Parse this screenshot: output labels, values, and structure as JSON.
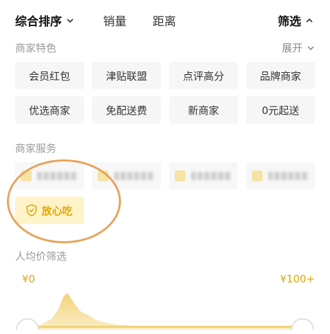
{
  "sort_bar": {
    "tabs": [
      "综合排序",
      "销量",
      "距离"
    ],
    "filter_label": "筛选"
  },
  "features": {
    "label": "商家特色",
    "expand_label": "展开",
    "chips": [
      "会员红包",
      "津贴联盟",
      "点评高分",
      "品牌商家",
      "优选商家",
      "免配送费",
      "新商家",
      "0元起送"
    ]
  },
  "services": {
    "label": "商家服务",
    "highlighted": "放心吃"
  },
  "price_filter": {
    "label": "人均价筛选",
    "min_label": "¥0",
    "max_label": "¥100+"
  },
  "colors": {
    "accent": "#e0a800",
    "highlight_ring": "#e8a35a",
    "chip_bg": "#f6f6f6",
    "highlight_bg": "#fff3c9"
  }
}
